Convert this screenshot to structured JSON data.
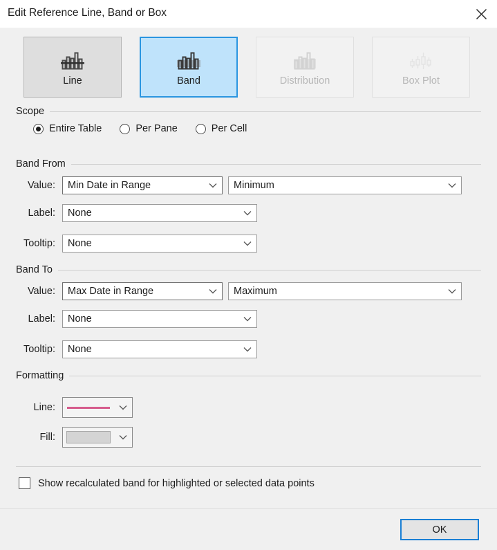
{
  "window": {
    "title": "Edit Reference Line, Band or Box",
    "close_icon": "close-icon"
  },
  "tabs": [
    {
      "label": "Line",
      "icon": "histogram-line-icon",
      "state": "normal"
    },
    {
      "label": "Band",
      "icon": "histogram-band-icon",
      "state": "selected"
    },
    {
      "label": "Distribution",
      "icon": "histogram-distribution-icon",
      "state": "disabled"
    },
    {
      "label": "Box Plot",
      "icon": "box-plot-icon",
      "state": "disabled"
    }
  ],
  "scope": {
    "title": "Scope",
    "options": [
      {
        "label": "Entire Table",
        "checked": true
      },
      {
        "label": "Per Pane",
        "checked": false
      },
      {
        "label": "Per Cell",
        "checked": false
      }
    ]
  },
  "band_from": {
    "title": "Band From",
    "value_label": "Value:",
    "value_field": "Min Date in Range",
    "aggregation_field": "Minimum",
    "label_label": "Label:",
    "label_field": "None",
    "tooltip_label": "Tooltip:",
    "tooltip_field": "None"
  },
  "band_to": {
    "title": "Band To",
    "value_label": "Value:",
    "value_field": "Max Date in Range",
    "aggregation_field": "Maximum",
    "label_label": "Label:",
    "label_field": "None",
    "tooltip_label": "Tooltip:",
    "tooltip_field": "None"
  },
  "formatting": {
    "title": "Formatting",
    "line_label": "Line:",
    "line_color": "#d65c8d",
    "fill_label": "Fill:",
    "fill_color": "#d4d4d4"
  },
  "recalculated": {
    "label": "Show recalculated band for highlighted or selected data points",
    "checked": false
  },
  "footer": {
    "ok_label": "OK"
  },
  "colors": {
    "accent_blue": "#1a7fd4",
    "tab_selected_bg": "#bfe3fb",
    "dialog_bg": "#f0f0f0"
  }
}
